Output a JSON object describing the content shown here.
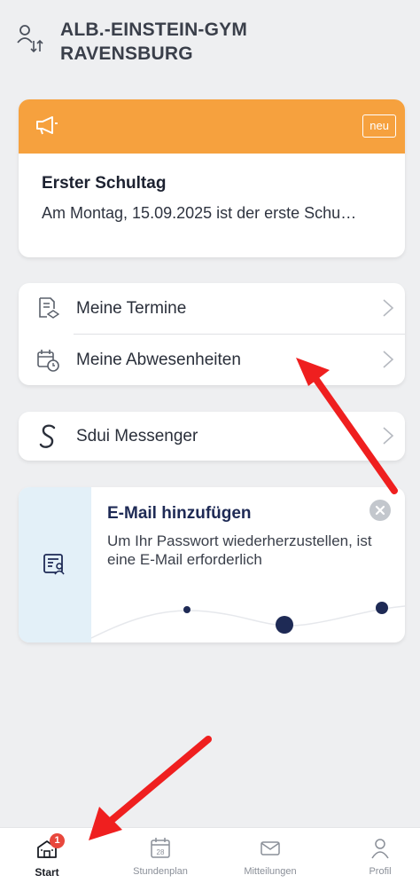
{
  "colors": {
    "accent_orange": "#f6a13e",
    "badge_red": "#e8473c",
    "email_panel": "#e3f0f8",
    "navy": "#1e2a55",
    "annotation_red": "#ef1f1f"
  },
  "header": {
    "school_name": "ALB.-EINSTEIN-GYM\nRAVENSBURG",
    "switch_icon": "person-switch-icon"
  },
  "news": {
    "icon": "megaphone-icon",
    "badge": "neu",
    "title": "Erster Schultag",
    "text": "Am Montag, 15.09.2025 ist der erste Schu…"
  },
  "menu": {
    "items": [
      {
        "label": "Meine Termine",
        "icon": "appointments-icon"
      },
      {
        "label": "Meine Abwesenheiten",
        "icon": "calendar-clock-icon"
      }
    ]
  },
  "messenger": {
    "label": "Sdui Messenger",
    "icon": "sdui-logo-icon"
  },
  "email_prompt": {
    "title": "E-Mail hinzufügen",
    "text": "Um Ihr Passwort wiederherzustellen, ist eine E-Mail erforderlich",
    "icon": "contact-card-icon"
  },
  "tabbar": {
    "tabs": [
      {
        "label": "Start",
        "icon": "school-icon",
        "badge": "1",
        "active": true
      },
      {
        "label": "Stundenplan",
        "icon": "calendar-icon",
        "calendar_day": "28"
      },
      {
        "label": "Mitteilungen",
        "icon": "envelope-icon"
      },
      {
        "label": "Profil",
        "icon": "person-icon"
      }
    ]
  }
}
